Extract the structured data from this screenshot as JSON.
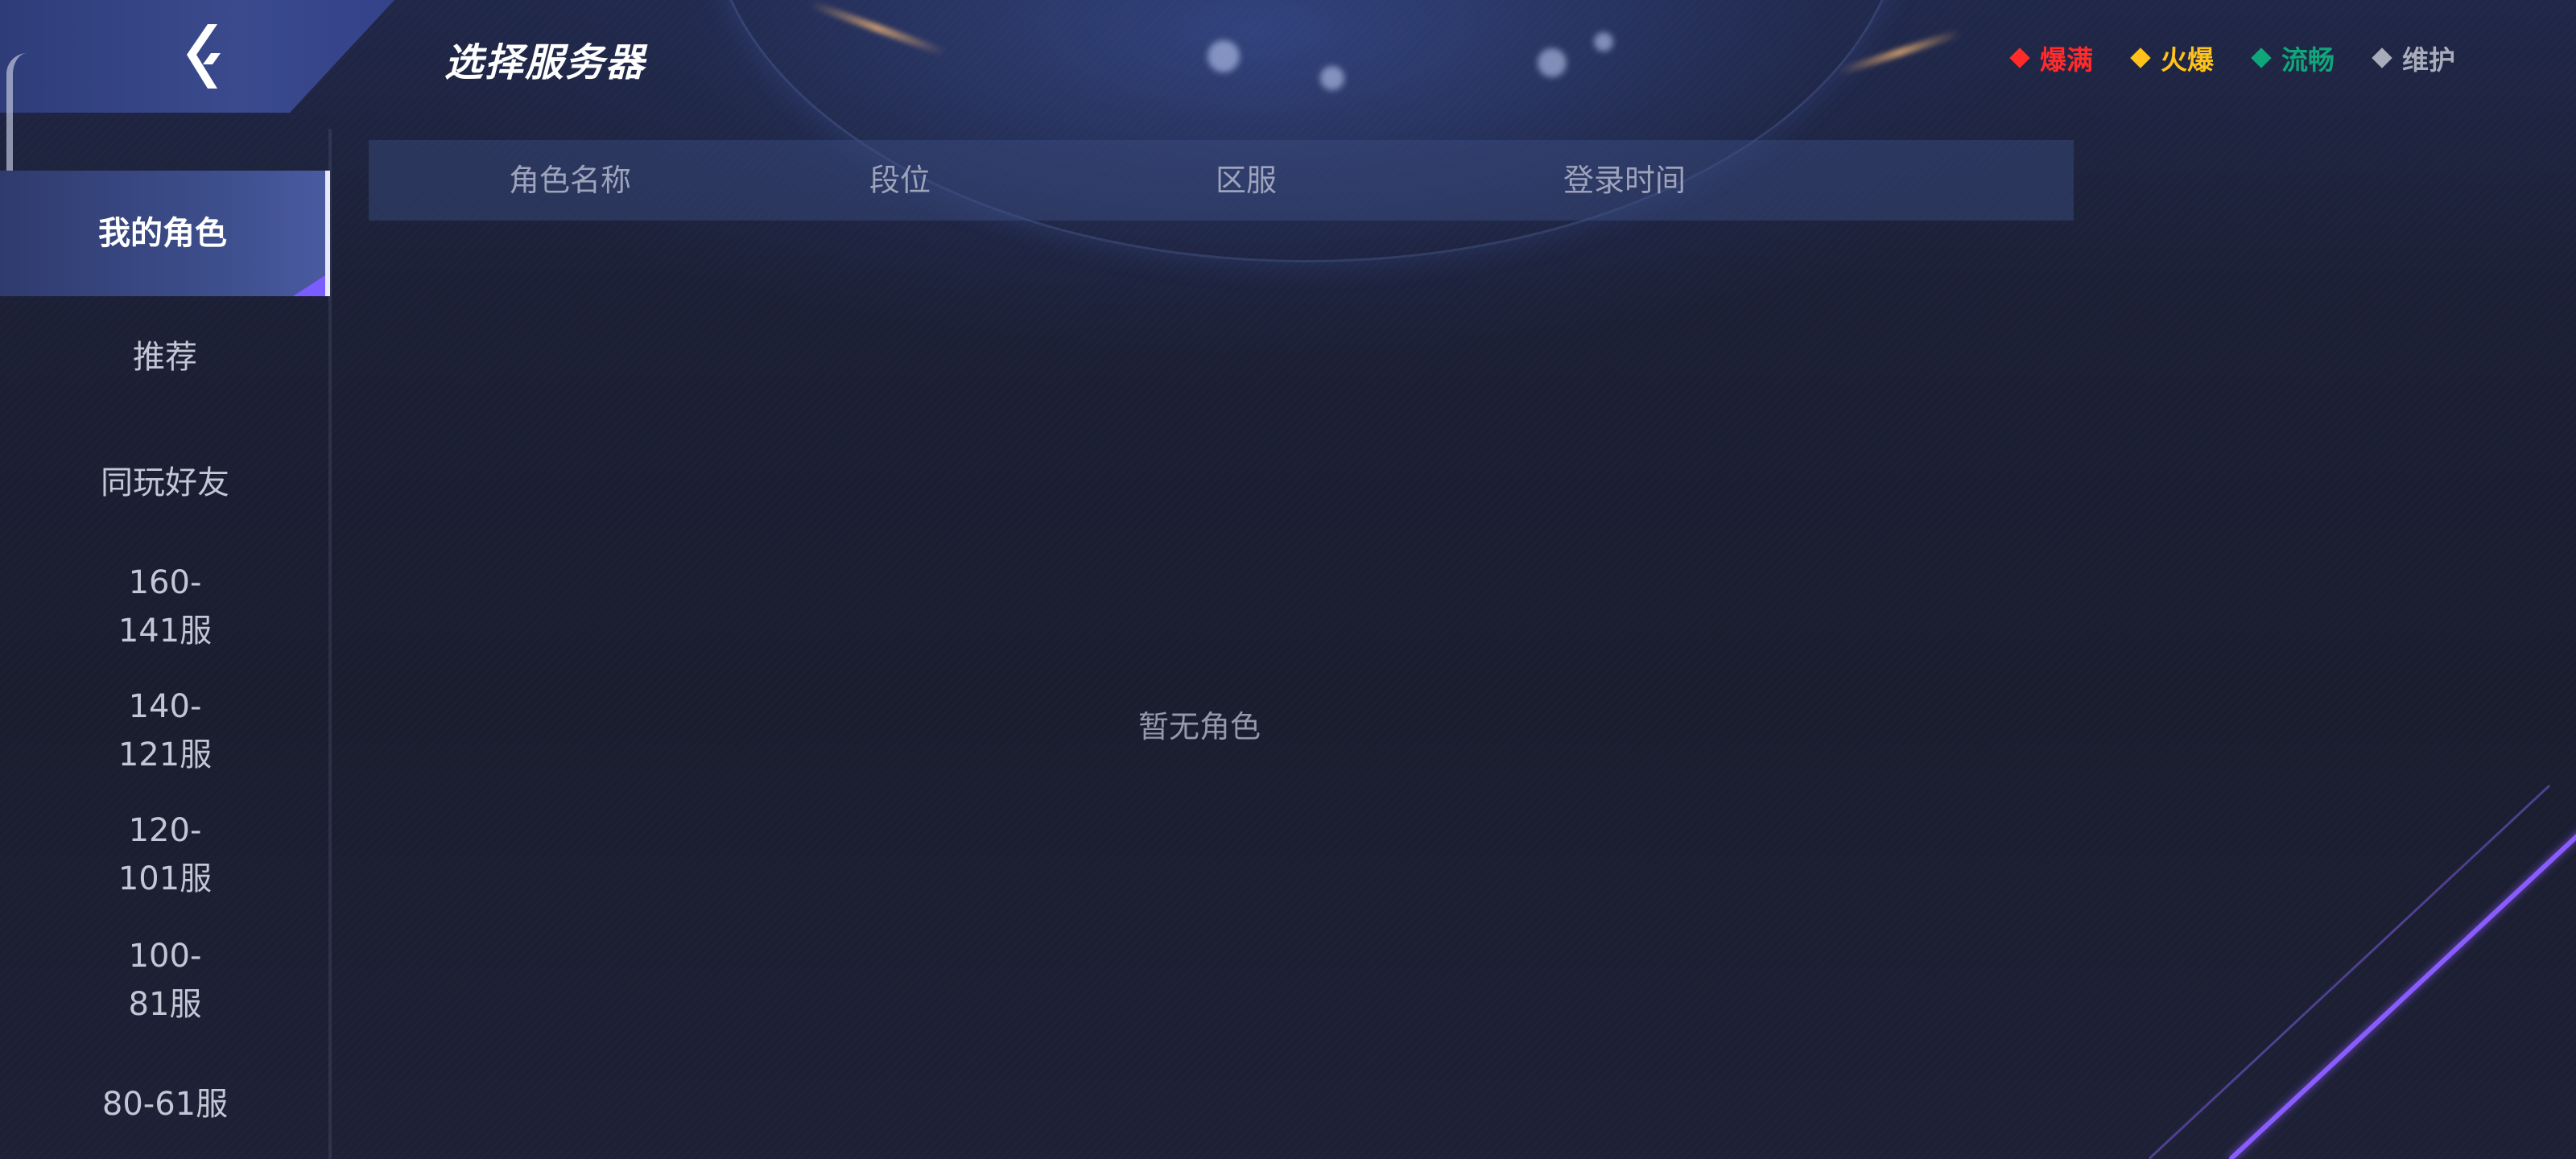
{
  "header": {
    "title": "选择服务器",
    "back_icon": "back-arrow-icon"
  },
  "legend": [
    {
      "label": "爆满",
      "color": "#ff2b2b"
    },
    {
      "label": "火爆",
      "color": "#ffc21a"
    },
    {
      "label": "流畅",
      "color": "#0fa67a"
    },
    {
      "label": "维护",
      "color": "#a9acba"
    }
  ],
  "sidebar": {
    "items": [
      {
        "label": "我的角色",
        "active": true
      },
      {
        "label": "推荐"
      },
      {
        "label": "同玩好友"
      },
      {
        "label": "160-\n141服"
      },
      {
        "label": "140-\n121服"
      },
      {
        "label": "120-\n101服"
      },
      {
        "label": "100-\n81服"
      },
      {
        "label": "80-61服"
      }
    ]
  },
  "table": {
    "columns": [
      "角色名称",
      "段位",
      "区服",
      "登录时间"
    ],
    "empty_text": "暂无角色"
  },
  "colors": {
    "accent": "#7b5cff",
    "active_tab": "#3e4f8e"
  }
}
